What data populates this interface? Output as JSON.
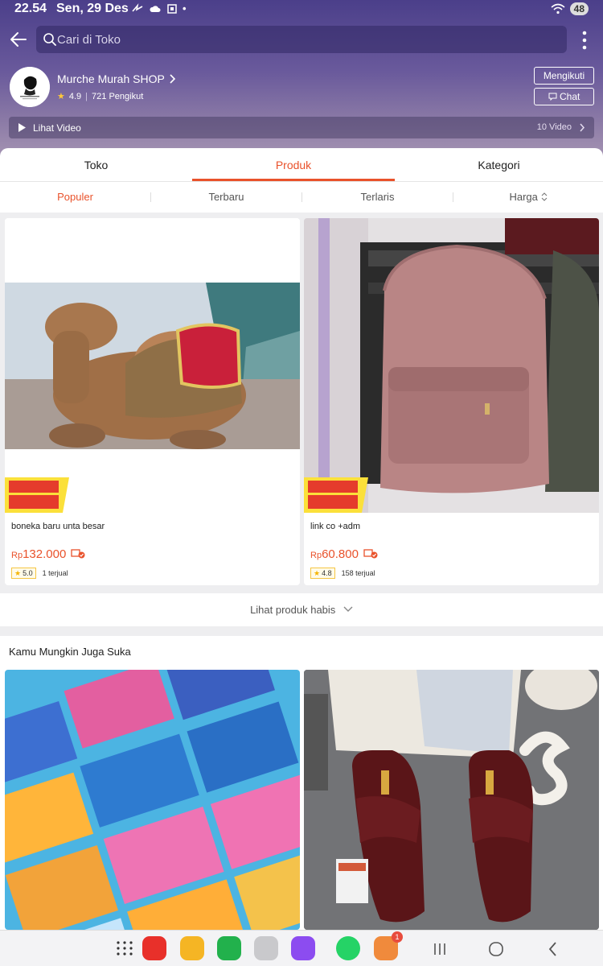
{
  "status_bar": {
    "time": "22.54",
    "date": "Sen, 29 Des",
    "battery": "48"
  },
  "search": {
    "placeholder": "Cari di Toko"
  },
  "shop": {
    "name": "Murche Murah SHOP",
    "rating": "4.9",
    "followers": "721 Pengikut",
    "follow_label": "Mengikuti",
    "chat_label": "Chat",
    "video_label": "Lihat Video",
    "video_count": "10 Video"
  },
  "tabs": [
    {
      "label": "Toko",
      "active": false
    },
    {
      "label": "Produk",
      "active": true
    },
    {
      "label": "Kategori",
      "active": false
    }
  ],
  "sort": [
    {
      "label": "Populer",
      "active": true
    },
    {
      "label": "Terbaru",
      "active": false
    },
    {
      "label": "Terlaris",
      "active": false
    },
    {
      "label": "Harga",
      "active": false
    }
  ],
  "products": [
    {
      "name": "boneka baru unta besar",
      "currency": "Rp",
      "price": "132.000",
      "rating": "5.0",
      "sold": "1 terjual",
      "promo": "PROMO XTRA"
    },
    {
      "name": "link co +adm",
      "currency": "Rp",
      "price": "60.800",
      "rating": "4.8",
      "sold": "158 terjual",
      "promo": "PROMO XTRA"
    }
  ],
  "soldout_label": "Lihat produk habis",
  "recommend_title": "Kamu Mungkin Juga Suka",
  "colors": {
    "accent": "#e9522b",
    "header": "#5b4c93"
  },
  "dock": {
    "badge_count": "1"
  }
}
